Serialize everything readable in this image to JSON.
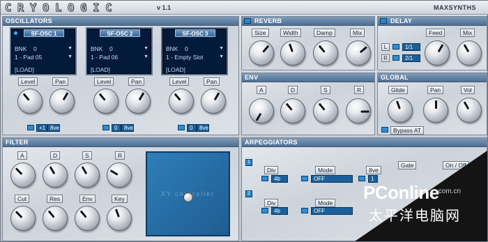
{
  "app": {
    "logo": "CRYOLOGIC",
    "version": "v 1.1",
    "brand": "MAXSYNTHS"
  },
  "oscillators": {
    "title": "OSCILLATORS",
    "units": [
      {
        "name": "SF-OSC 1",
        "bank_label": "BNK",
        "bank_value": "0",
        "patch": "1 - Pad 05",
        "load": "[LOAD]",
        "level_label": "Level",
        "pan_label": "Pan",
        "octave_value": "+1",
        "octave_label": "8ve",
        "level_angle": -40,
        "pan_angle": 30
      },
      {
        "name": "SF-OSC 2",
        "bank_label": "BNK",
        "bank_value": "0",
        "patch": "1 - Pad 06",
        "load": "[LOAD]",
        "level_label": "Level",
        "pan_label": "Pan",
        "octave_value": "0",
        "octave_label": "8ve",
        "level_angle": -40,
        "pan_angle": 30
      },
      {
        "name": "SF-OSC 3",
        "bank_label": "BNK",
        "bank_value": "0",
        "patch": "1 - Empty Slot",
        "load": "[LOAD]",
        "level_label": "Level",
        "pan_label": "Pan",
        "octave_value": "0",
        "octave_label": "8ve",
        "level_angle": -40,
        "pan_angle": 30
      }
    ]
  },
  "reverb": {
    "title": "REVERB",
    "knobs": [
      {
        "label": "Size",
        "angle": 40
      },
      {
        "label": "Width",
        "angle": -20
      },
      {
        "label": "Damp",
        "angle": -40
      },
      {
        "label": "Mix",
        "angle": 50
      }
    ]
  },
  "delay": {
    "title": "DELAY",
    "left_label": "L",
    "left_value": "1/1",
    "right_label": "R",
    "right_value": "2/1",
    "knobs": [
      {
        "label": "Feed",
        "angle": 30
      },
      {
        "label": "Mix",
        "angle": -30
      }
    ]
  },
  "env": {
    "title": "ENV",
    "knobs": [
      {
        "label": "A",
        "angle": -150
      },
      {
        "label": "D",
        "angle": -40
      },
      {
        "label": "S",
        "angle": -40
      },
      {
        "label": "R",
        "angle": 90
      }
    ]
  },
  "global": {
    "title": "GLOBAL",
    "knobs": [
      {
        "label": "Glide",
        "angle": -20
      },
      {
        "label": "Pan",
        "angle": 0
      },
      {
        "label": "Vol",
        "angle": -30
      }
    ],
    "bypass_label": "Bypass AT"
  },
  "filter": {
    "title": "FILTER",
    "row1": [
      {
        "label": "A",
        "angle": -45
      },
      {
        "label": "D",
        "angle": -30
      },
      {
        "label": "S",
        "angle": -30
      },
      {
        "label": "R",
        "angle": -60
      }
    ],
    "row2": [
      {
        "label": "Cut",
        "angle": -45
      },
      {
        "label": "Res",
        "angle": -40
      },
      {
        "label": "Env",
        "angle": -40
      },
      {
        "label": "Key",
        "angle": -20
      }
    ],
    "xy_label": "XY controller"
  },
  "arpeggiators": {
    "title": "ARPEGGIATORS",
    "rows": [
      {
        "num": "1",
        "div_label": "Div",
        "div_value": "4b",
        "mode_label": "Mode",
        "mode_value": "OFF",
        "octave_label": "8ve",
        "octave_value": "1",
        "gate_label": "Gate",
        "onoff_label": "On / Off"
      },
      {
        "num": "2",
        "div_label": "Div",
        "div_value": "4b",
        "mode_label": "Mode",
        "mode_value": "OFF"
      }
    ]
  },
  "watermark": {
    "logo": "PConline",
    "domain": ".com.cn",
    "chinese": "太平洋电脑网"
  }
}
